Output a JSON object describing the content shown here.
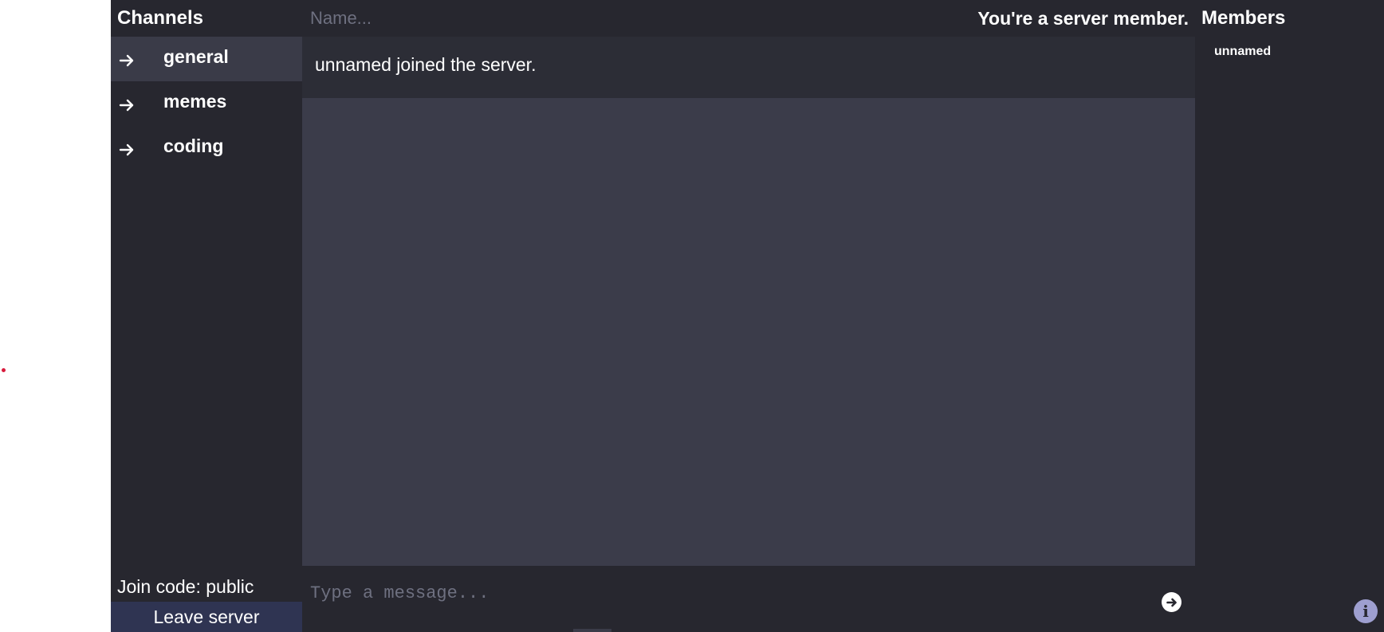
{
  "sidebar": {
    "title": "Channels",
    "channels": [
      {
        "name": "general",
        "active": true
      },
      {
        "name": "memes",
        "active": false
      },
      {
        "name": "coding",
        "active": false
      }
    ],
    "join_code": "Join code: public",
    "leave_label": "Leave server"
  },
  "header": {
    "name_placeholder": "Name...",
    "member_status": "You're a server member."
  },
  "chat": {
    "messages": [
      {
        "text": "unnamed joined the server."
      }
    ]
  },
  "composer": {
    "placeholder": "Type a message...",
    "send_icon": "arrow-right-circle-icon"
  },
  "members": {
    "title": "Members",
    "list": [
      {
        "name": "unnamed"
      }
    ],
    "info_icon": "info-icon"
  },
  "colors": {
    "panel": "#27272f",
    "chat_bg": "#3b3c4a",
    "active_channel": "#3a3b48",
    "leave_button": "#2f3452",
    "info_button": "#9e9fd0"
  }
}
